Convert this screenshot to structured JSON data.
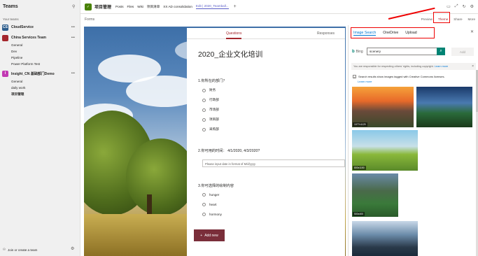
{
  "sidebar": {
    "title": "Teams",
    "your_teams": "Your teams",
    "teams": [
      {
        "name": "CloudService",
        "initial": "CS",
        "color": "#2d5d8c",
        "channels": []
      },
      {
        "name": "China Services Team",
        "initial": "",
        "color": "#a4262c",
        "channels": [
          "General",
          "Dev",
          "Pipeline",
          "Power Platform Test"
        ]
      },
      {
        "name": "Insight_CN 基础部门Demo",
        "initial": "I",
        "color": "#c239b3",
        "channels": [
          "General",
          "daily work",
          "项目管理"
        ]
      }
    ],
    "join_label": "Join or create a team"
  },
  "topbar": {
    "team_name": "项目管理",
    "tabs": [
      "Posts",
      "Files",
      "Wiki",
      "项目清单",
      "XX AD consolidation",
      "Edit | 2020_Teamball..."
    ]
  },
  "subbar": {
    "forms_label": "Forms",
    "actions": [
      "Preview",
      "Theme",
      "Share",
      "More"
    ]
  },
  "form": {
    "tab_questions": "Questions",
    "tab_responses": "Responses",
    "title": "2020_企业文化培训",
    "q1": {
      "title": "1.你所在的部门？",
      "options": [
        "财务",
        "行政部",
        "市场部",
        "项目部",
        "采购部"
      ]
    },
    "q2": {
      "title": "2.你可用的时间： 4/1/2020, 4/3/2020?",
      "placeholder": "Please input date in format of M/d/yyyy"
    },
    "q3": {
      "title": "3.你可选择的绘制内容",
      "options": [
        "hunger",
        "heart",
        "hormony"
      ]
    },
    "add_new": "Add new"
  },
  "panel": {
    "tabs": [
      "Image Search",
      "OneDrive",
      "Upload"
    ],
    "bing": "Bing",
    "search_value": "scenery",
    "add_label": "Add",
    "notice": "You are responsible for respecting others' rights, including copyright.",
    "learn_more": "Learn more",
    "cc_label": "Search results show images tagged with Creative Commons licenses.",
    "sizes": [
      "1077x1129",
      "",
      "800x1150",
      "",
      "500x400"
    ]
  },
  "colors": {
    "accent": "#5b5fc7",
    "forms_red": "#a4262c",
    "bing": "#008373",
    "highlight": "#ee0000"
  }
}
